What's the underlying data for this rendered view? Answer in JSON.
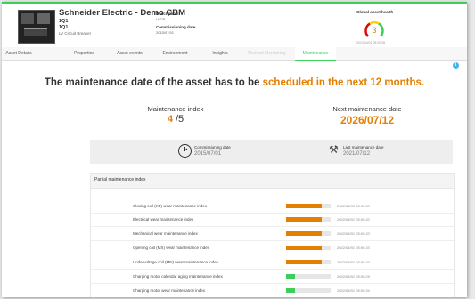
{
  "asset": {
    "title": "Schneider Electric - Demo CBM",
    "line1": "1Q1",
    "line2": "1Q1",
    "type": "LV Circuit Breaker",
    "description_label": "Description",
    "description_value": "LVCB",
    "commissioning_label": "Commissioning date",
    "commissioning_value": "2015/07/01"
  },
  "health": {
    "label": "Global asset health",
    "value": "3",
    "date": "2022/04/01 05:00:28",
    "color": "#e47f00"
  },
  "tabs": [
    {
      "label": "Asset Details",
      "state": "normal"
    },
    {
      "label": "Properties",
      "state": "normal"
    },
    {
      "label": "Asset events",
      "state": "normal"
    },
    {
      "label": "Environment",
      "state": "normal"
    },
    {
      "label": "Insights",
      "state": "normal"
    },
    {
      "label": "Thermal Monitoring",
      "state": "disabled"
    },
    {
      "label": "Maintenance",
      "state": "active"
    }
  ],
  "headline": {
    "text_before": "The maintenance date of the asset has to be ",
    "text_highlight": "scheduled in the next 12 months."
  },
  "maintenance_index": {
    "label": "Maintenance index",
    "value": "4",
    "max": "/5"
  },
  "next_maintenance": {
    "label": "Next maintenance date",
    "value": "2026/07/12"
  },
  "dates": {
    "commissioning_label": "Commissioning date",
    "commissioning_value": "2015/07/01",
    "last_label": "Last maintenance date",
    "last_value": "2021/07/12"
  },
  "partial": {
    "title": "Partial maintenance index",
    "rows": [
      {
        "label": "Closing coil (XF) wear maintenance index",
        "level": 0.8,
        "color": "#e47f00",
        "date": "2022/04/01 05:00:30"
      },
      {
        "label": "Electrical wear maintenance index",
        "level": 0.8,
        "color": "#e47f00",
        "date": "2022/04/01 05:00:32"
      },
      {
        "label": "Mechanical wear maintenance index",
        "level": 0.8,
        "color": "#e47f00",
        "date": "2022/04/01 05:00:33"
      },
      {
        "label": "Opening coil (MX) wear maintenance index",
        "level": 0.8,
        "color": "#e47f00",
        "date": "2022/04/01 05:00:33"
      },
      {
        "label": "Undervoltage coil (MN) wear maintenance index",
        "level": 0.8,
        "color": "#e47f00",
        "date": "2022/04/01 05:00:32"
      },
      {
        "label": "Charging motor calendar aging maintenance index",
        "level": 0.2,
        "color": "#3dcd58",
        "date": "2022/04/01 05:00:29"
      },
      {
        "label": "Charging motor wear maintenance index",
        "level": 0.2,
        "color": "#3dcd58",
        "date": "2022/04/01 05:00:34"
      }
    ]
  }
}
